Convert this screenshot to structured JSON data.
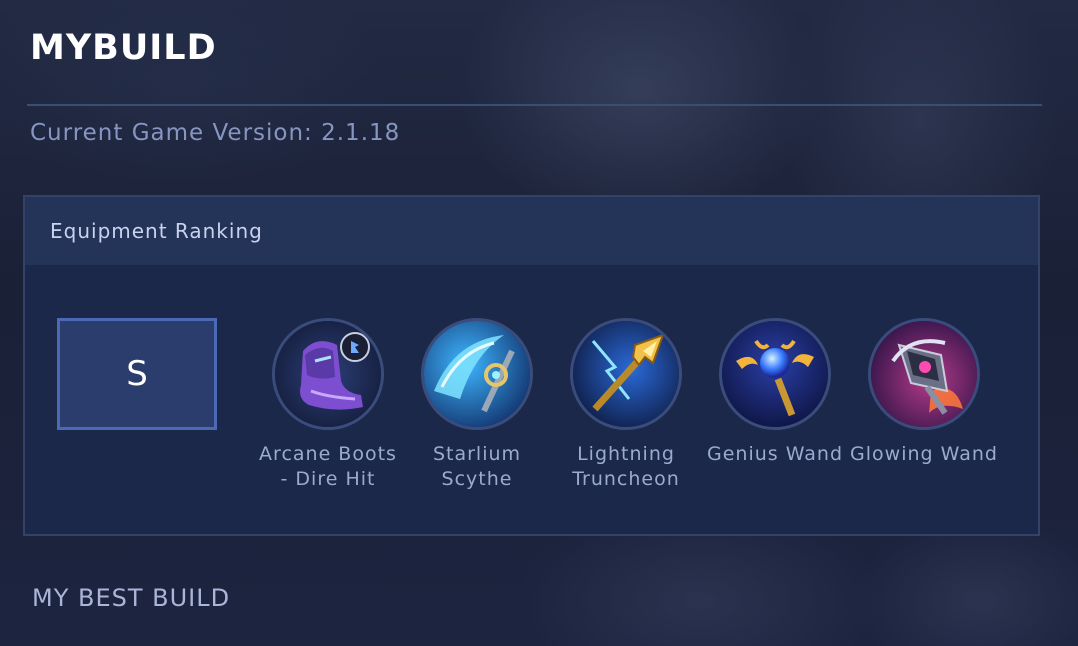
{
  "header": {
    "title": "MYBUILD",
    "version_text": "Current Game Version: 2.1.18"
  },
  "equipment_ranking": {
    "title": "Equipment Ranking",
    "tier": "S",
    "items": [
      {
        "name": "Arcane Boots - Dire Hit",
        "icon": "arcane-boots-icon"
      },
      {
        "name": "Starlium Scythe",
        "icon": "starlium-scythe-icon"
      },
      {
        "name": "Lightning Truncheon",
        "icon": "lightning-truncheon-icon"
      },
      {
        "name": "Genius Wand",
        "icon": "genius-wand-icon"
      },
      {
        "name": "Glowing Wand",
        "icon": "glowing-wand-icon"
      }
    ]
  },
  "best_build": {
    "title": "MY BEST BUILD"
  },
  "colors": {
    "accent": "#4b69b5",
    "panel": "#1b284a",
    "panel_header": "#243358",
    "muted_text": "#9caad0"
  }
}
